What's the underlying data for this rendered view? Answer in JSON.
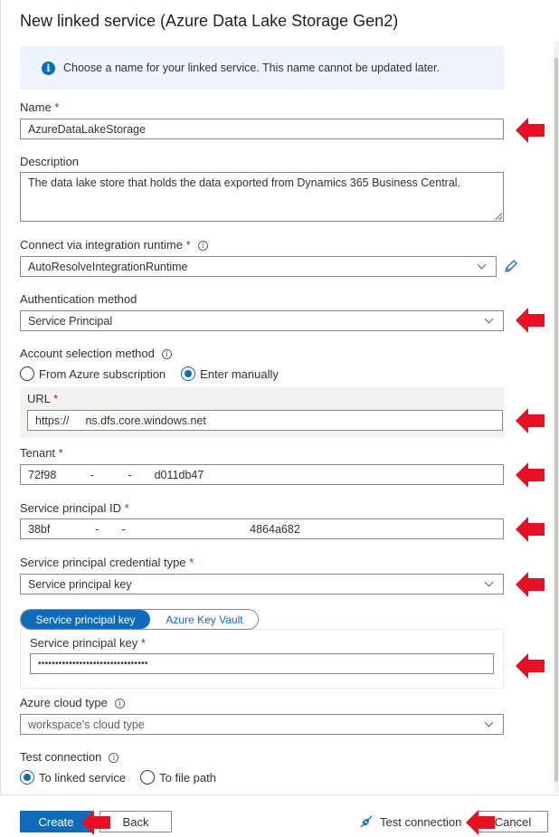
{
  "panel": {
    "title": "New linked service (Azure Data Lake Storage Gen2)",
    "info_message": "Choose a name for your linked service. This name cannot be updated later."
  },
  "fields": {
    "name": {
      "label": "Name",
      "required": "*",
      "value": "AzureDataLakeStorage"
    },
    "description": {
      "label": "Description",
      "value": "The data lake store that holds the data exported from Dynamics 365 Business Central."
    },
    "runtime": {
      "label": "Connect via integration runtime",
      "required": "*",
      "value": "AutoResolveIntegrationRuntime"
    },
    "auth_method": {
      "label": "Authentication method",
      "value": "Service Principal"
    },
    "account_selection": {
      "label": "Account selection method",
      "option_1": "From Azure subscription",
      "option_2": "Enter manually",
      "selected": "Enter manually"
    },
    "url": {
      "label": "URL",
      "required": "*",
      "value": "https://      ns.dfs.core.windows.net"
    },
    "tenant": {
      "label": "Tenant",
      "required": "*",
      "value": "72f98      -      -    d011db47"
    },
    "sp_id": {
      "label": "Service principal ID",
      "required": "*",
      "value": "38bf        -    -                      4864a682"
    },
    "cred_type": {
      "label": "Service principal credential type",
      "required": "*",
      "value": "Service principal key"
    },
    "cred_toggle": {
      "option_1": "Service principal key",
      "option_2": "Azure Key Vault",
      "selected": "Service principal key"
    },
    "sp_key": {
      "label": "Service principal key",
      "required": "*",
      "value": "••••••••••••••••••••••••••••••••"
    },
    "cloud_type": {
      "label": "Azure cloud type",
      "value": "workspace's cloud type"
    },
    "test_connection": {
      "label": "Test connection",
      "option_1": "To linked service",
      "option_2": "To file path",
      "selected": "To linked service"
    }
  },
  "footer": {
    "create_label": "Create",
    "back_label": "Back",
    "test_connection_label": "Test connection",
    "cancel_label": "Cancel"
  },
  "colors": {
    "accent": "#0f6cbd",
    "annotation_arrow": "#e81123",
    "required": "#a4262c",
    "info_bg": "#eef4fc"
  },
  "icons": {
    "info": "info-icon",
    "hint": "info-outline-icon",
    "edit": "pencil-icon",
    "test": "plug-icon",
    "annotation": "red-arrow-left-icon"
  }
}
